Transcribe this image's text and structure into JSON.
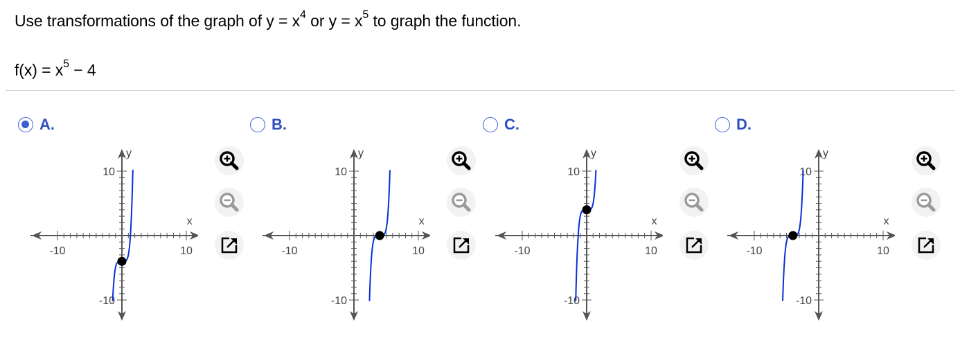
{
  "question": {
    "line1": {
      "part1": "Use transformations of the graph of y = x",
      "exp1": "4",
      "part2": " or y = x",
      "exp2": "5",
      "part3": " to graph the function."
    },
    "line2": {
      "part1": "f(x) = x",
      "exp1": "5",
      "part2": " − 4"
    }
  },
  "choices": [
    {
      "letter": "A.",
      "selected": true
    },
    {
      "letter": "B.",
      "selected": false
    },
    {
      "letter": "C.",
      "selected": false
    },
    {
      "letter": "D.",
      "selected": false
    }
  ],
  "graph_labels": {
    "x_axis": "x",
    "y_axis": "y",
    "tick_neg10": "-10",
    "tick_pos10": "10"
  },
  "chart_data": [
    {
      "type": "line",
      "function": "y = x^5 - 4",
      "key_point": [
        0,
        -4
      ],
      "xlim": [
        -10,
        10
      ],
      "ylim": [
        -10,
        10
      ],
      "x_ticks": [
        -10,
        10
      ],
      "y_ticks": [
        -10,
        10
      ],
      "grid": false
    },
    {
      "type": "line",
      "function": "y = (x - 4)^5",
      "key_point": [
        4,
        0
      ],
      "xlim": [
        -10,
        10
      ],
      "ylim": [
        -10,
        10
      ],
      "x_ticks": [
        -10,
        10
      ],
      "y_ticks": [
        -10,
        10
      ],
      "grid": false
    },
    {
      "type": "line",
      "function": "y = x^5 + 4",
      "key_point": [
        0,
        4
      ],
      "xlim": [
        -10,
        10
      ],
      "ylim": [
        -10,
        10
      ],
      "x_ticks": [
        -10,
        10
      ],
      "y_ticks": [
        -10,
        10
      ],
      "grid": false
    },
    {
      "type": "line",
      "function": "y = (x + 4)^5",
      "key_point": [
        -4,
        0
      ],
      "xlim": [
        -10,
        10
      ],
      "ylim": [
        -10,
        10
      ],
      "x_ticks": [
        -10,
        10
      ],
      "y_ticks": [
        -10,
        10
      ],
      "grid": false
    }
  ],
  "colors": {
    "curve": "#0a2fd6",
    "point": "#000000",
    "accent": "#2f4fc0",
    "zoom_in_bg": "#000000",
    "zoom_out_bg": "#9a9a9a"
  },
  "icons": {
    "zoom_in": "zoom-in-icon",
    "zoom_out": "zoom-out-icon",
    "popout": "popout-icon"
  }
}
